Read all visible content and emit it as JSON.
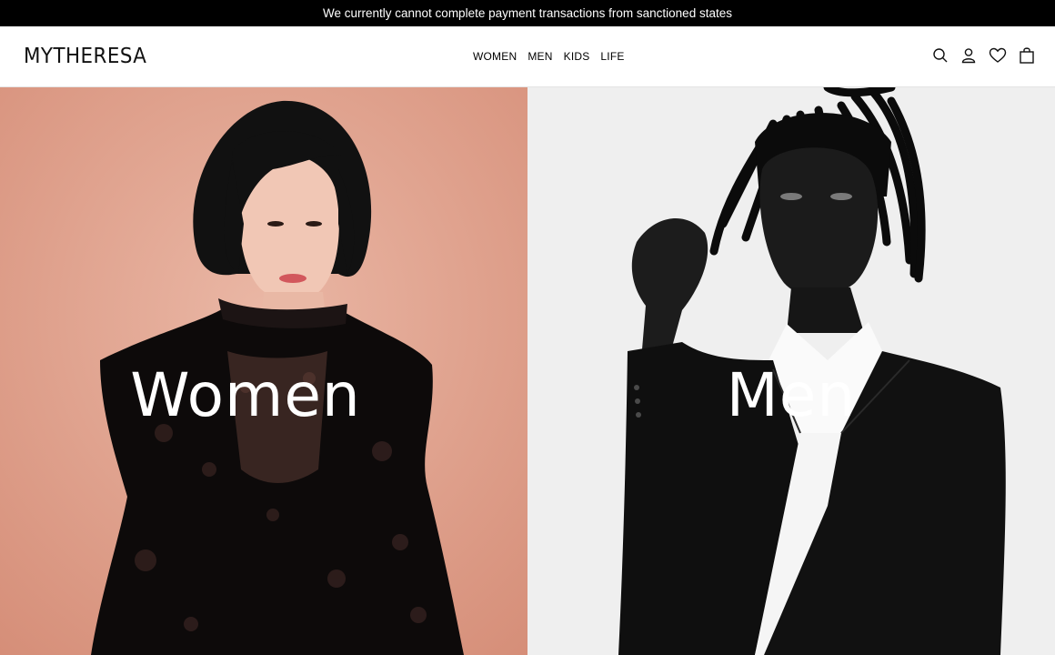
{
  "announcement": "We currently cannot complete payment transactions from sanctioned states",
  "header": {
    "logo": "MYTHERESA",
    "nav": [
      "WOMEN",
      "MEN",
      "KIDS",
      "LIFE"
    ],
    "icons": [
      "search-icon",
      "account-icon",
      "wishlist-icon",
      "shopping-bag-icon"
    ]
  },
  "hero": {
    "women_label": "Women",
    "men_label": "Men"
  },
  "colors": {
    "topbar": "#000000",
    "women_bg": "#e2a592",
    "men_bg": "#efefef"
  }
}
